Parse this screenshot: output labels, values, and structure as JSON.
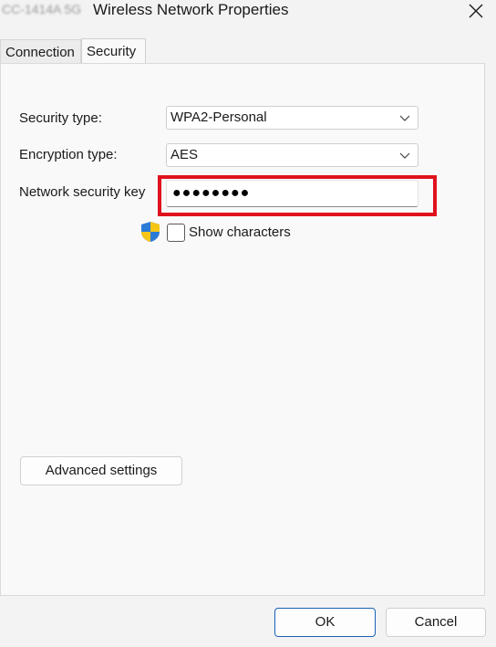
{
  "window": {
    "title_prefix": "CC-1414A 5G",
    "title": "Wireless Network Properties"
  },
  "tabs": [
    {
      "label": "Connection",
      "active": false
    },
    {
      "label": "Security",
      "active": true
    }
  ],
  "security": {
    "security_type_label": "Security type:",
    "security_type_value": "WPA2-Personal",
    "encryption_type_label": "Encryption type:",
    "encryption_type_value": "AES",
    "network_key_label": "Network security key",
    "network_key_value": "●●●●●●●●",
    "show_characters_label": "Show characters",
    "show_characters_checked": false,
    "highlight_color": "#e0121d"
  },
  "buttons": {
    "advanced": "Advanced settings",
    "ok": "OK",
    "cancel": "Cancel"
  },
  "icons": {
    "close": "close-icon",
    "dropdown": "chevron-down-icon",
    "uac_shield": "shield-icon"
  }
}
